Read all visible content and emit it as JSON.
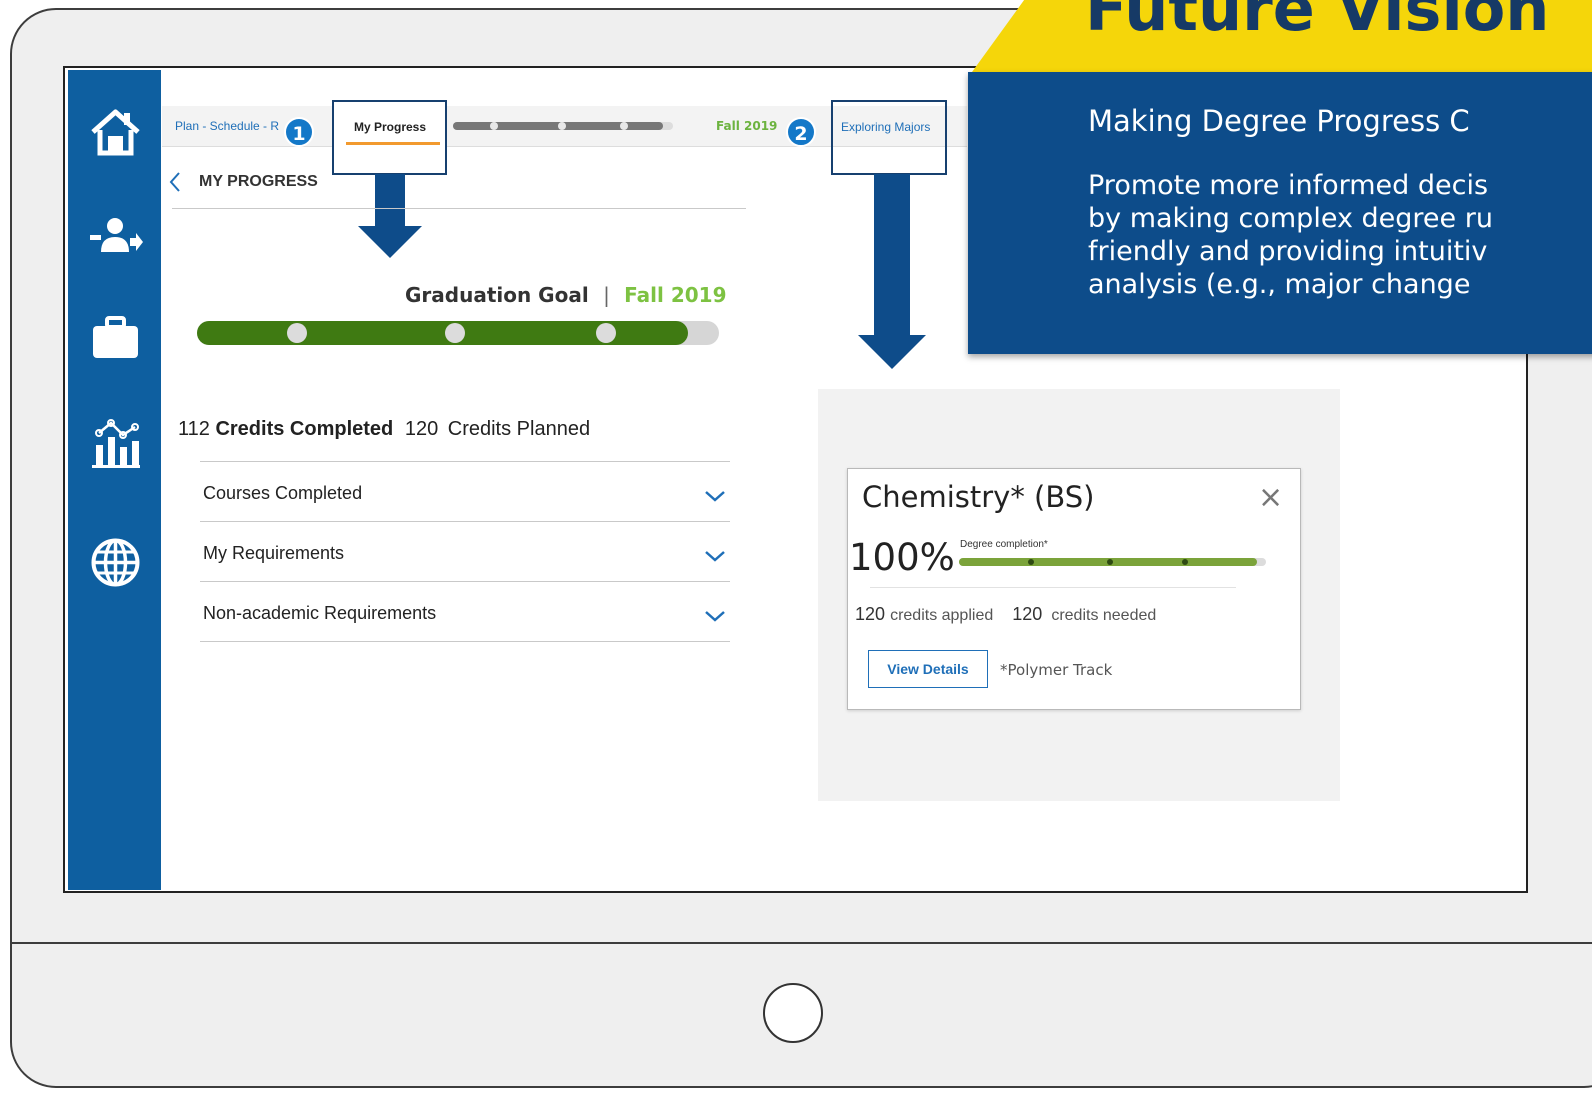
{
  "nav": {
    "breadcrumb": "Plan - Schedule - R",
    "tab_active": "My Progress",
    "term": "Fall 2019",
    "tab_majors": "Exploring Majors"
  },
  "badges": [
    "1",
    "2"
  ],
  "progress": {
    "title": "MY PROGRESS",
    "goal_label": "Graduation Goal",
    "separator": "|",
    "goal_term": "Fall 2019",
    "goal_progress_fraction": 0.94,
    "credits_completed_value": "112",
    "credits_completed_label": "Credits Completed",
    "credits_planned_value": "120",
    "credits_planned_label": "Credits Planned",
    "accordion": [
      {
        "label": "Courses Completed"
      },
      {
        "label": "My Requirements"
      },
      {
        "label": "Non-academic Requirements"
      }
    ]
  },
  "banner": {
    "title": "Future Vision",
    "heading": "Making Degree Progress C",
    "lines": [
      "Promote more informed decis",
      "by making complex degree ru",
      "friendly and providing intuitiv",
      "analysis (e.g., major change"
    ]
  },
  "major_card": {
    "title": "Chemistry* (BS)",
    "close": "×",
    "percent": "100%",
    "completion_label": "Degree completion*",
    "completion_fraction": 0.97,
    "credits_applied_value": "120",
    "credits_applied_label": "credits applied",
    "credits_needed_value": "120",
    "credits_needed_label": "credits needed",
    "details_button": "View Details",
    "track_note": "*Polymer Track"
  },
  "colors": {
    "sidebar": "#0e5fa0",
    "accent_green": "#7dc242",
    "progress_green": "#3f7a12",
    "banner_blue": "#0d4c8a",
    "banner_yellow": "#f5d60a",
    "tab_underline": "#f29a2e"
  },
  "icons": {
    "sidebar": [
      "home-icon",
      "transfer-user-icon",
      "briefcase-icon",
      "analytics-icon",
      "globe-icon"
    ]
  }
}
